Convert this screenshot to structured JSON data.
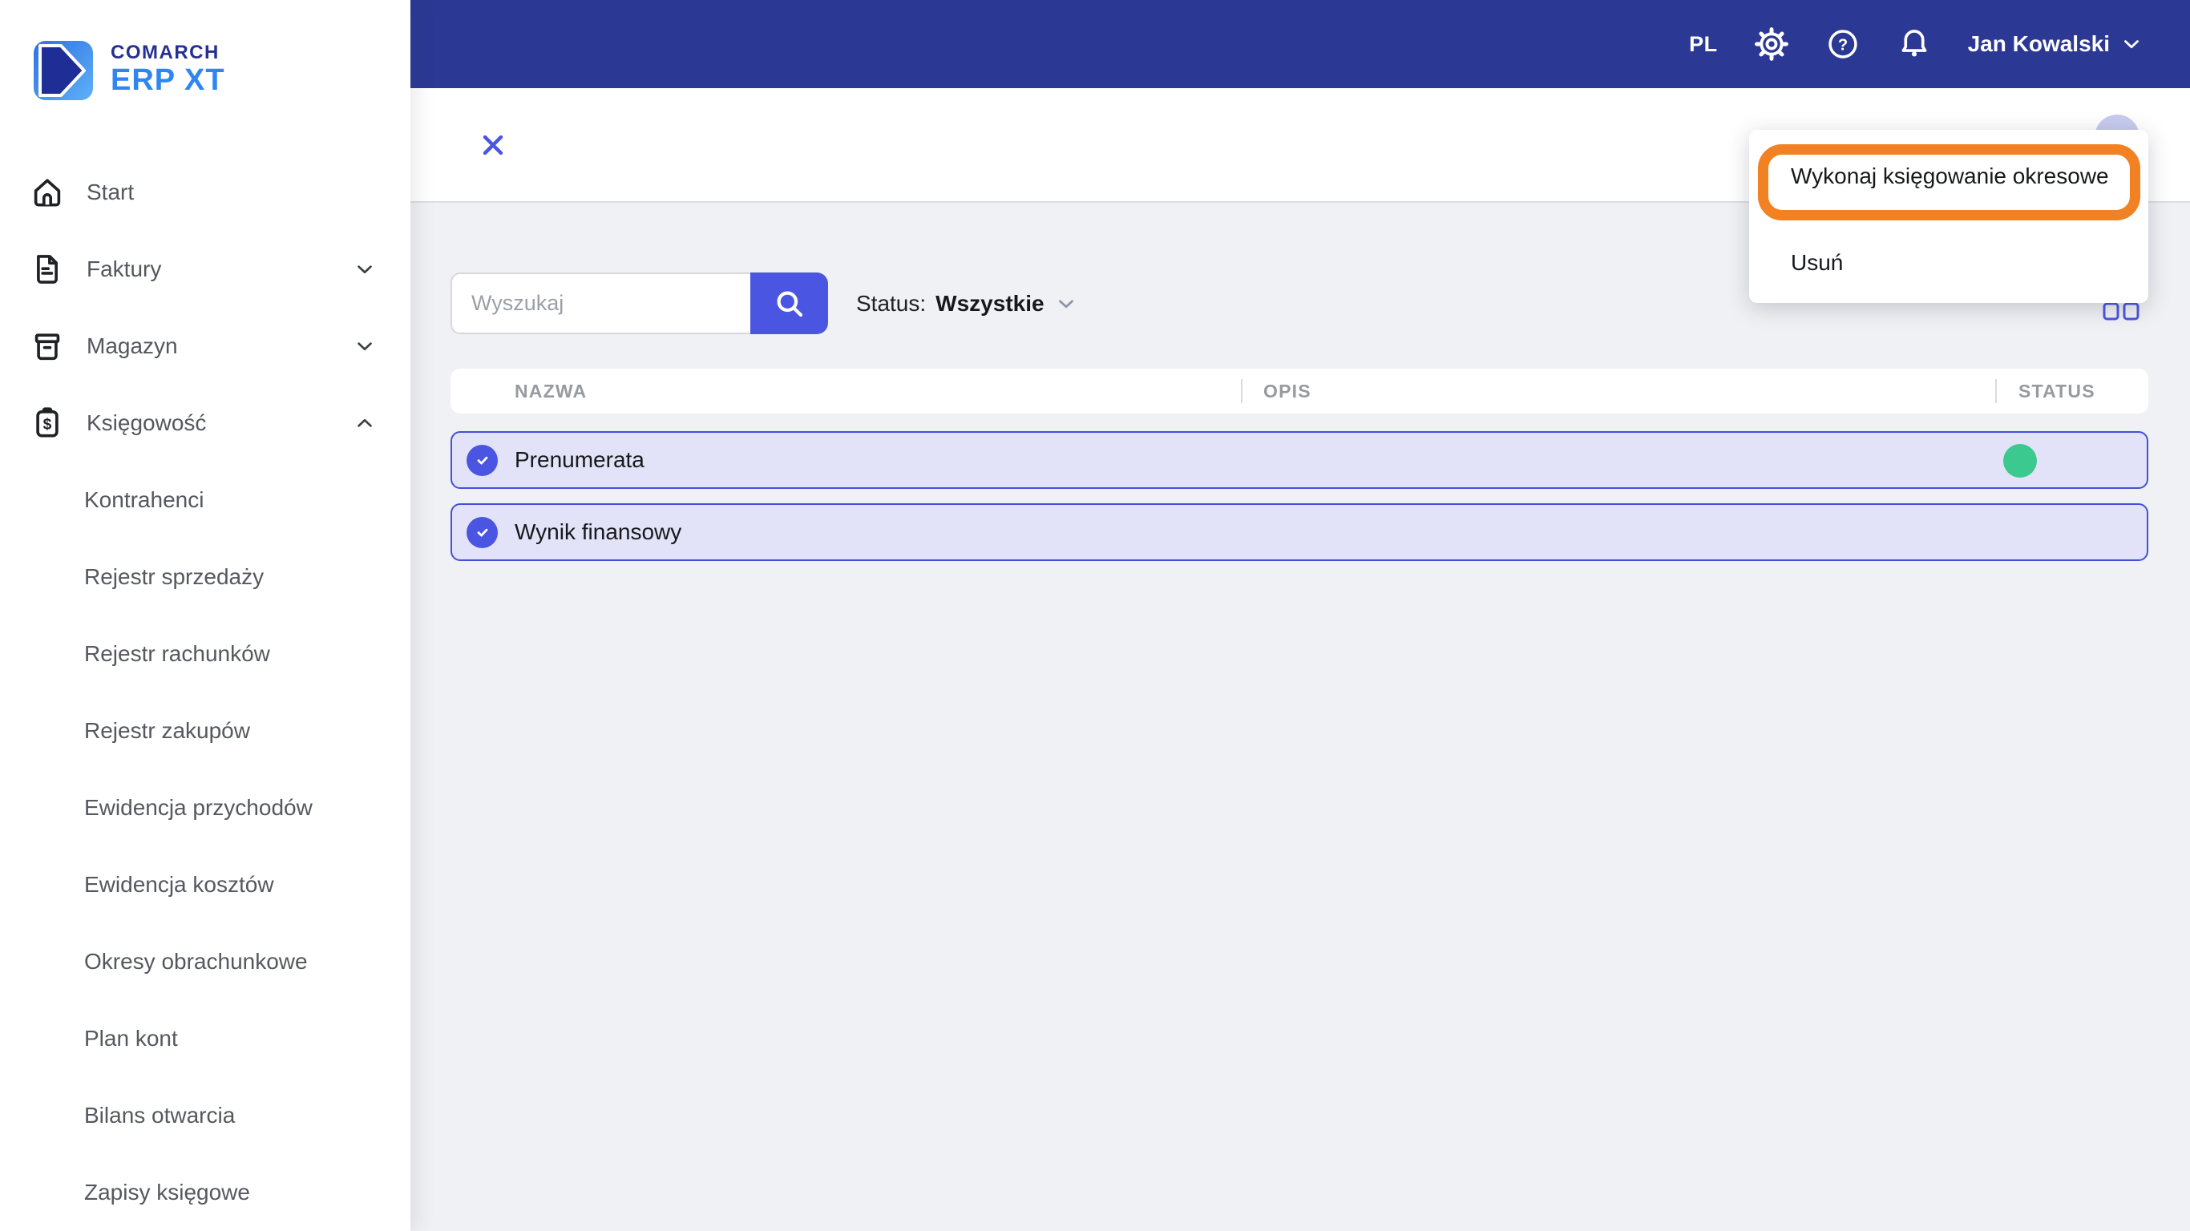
{
  "brand": {
    "line1": "COMARCH",
    "line2": "ERP XT"
  },
  "topbar": {
    "language": "PL",
    "user_name": "Jan Kowalski",
    "icons": [
      "gear-icon",
      "help-icon",
      "bell-icon"
    ]
  },
  "sidebar": {
    "items": [
      {
        "label": "Start",
        "icon": "home-icon",
        "chevron": "none"
      },
      {
        "label": "Faktury",
        "icon": "invoice-icon",
        "chevron": "down"
      },
      {
        "label": "Magazyn",
        "icon": "warehouse-icon",
        "chevron": "down"
      },
      {
        "label": "Księgowość",
        "icon": "accounting-icon",
        "chevron": "up",
        "expanded": true
      }
    ],
    "subitems": [
      {
        "label": "Kontrahenci"
      },
      {
        "label": "Rejestr sprzedaży"
      },
      {
        "label": "Rejestr rachunków"
      },
      {
        "label": "Rejestr zakupów"
      },
      {
        "label": "Ewidencja przychodów"
      },
      {
        "label": "Ewidencja kosztów"
      },
      {
        "label": "Okresy obrachunkowe"
      },
      {
        "label": "Plan kont"
      },
      {
        "label": "Bilans otwarcia"
      },
      {
        "label": "Zapisy księgowe"
      }
    ]
  },
  "content": {
    "search": {
      "placeholder": "Wyszukaj",
      "value": ""
    },
    "status_filter": {
      "label": "Status:",
      "value": "Wszystkie"
    },
    "table": {
      "columns": [
        "NAZWA",
        "OPIS",
        "STATUS"
      ],
      "rows": [
        {
          "name": "Prenumerata",
          "description": "",
          "checked": true,
          "status": "active",
          "status_color": "#3cc98f"
        },
        {
          "name": "Wynik finansowy",
          "description": "",
          "checked": true,
          "status": "none"
        }
      ]
    },
    "context_menu": {
      "items": [
        {
          "label": "Wykonaj księgowanie okresowe",
          "highlighted": true
        },
        {
          "label": "Usuń",
          "highlighted": false
        }
      ],
      "annotation_color": "#f18122"
    }
  },
  "colors": {
    "topbar_navy": "#2b3994",
    "accent_indigo": "#4a55e1",
    "row_border": "#4450d8",
    "row_fill": "#e2e3f8",
    "status_green": "#3cc98f",
    "annotation_orange": "#f18122",
    "background_gray": "#f0f1f4"
  }
}
